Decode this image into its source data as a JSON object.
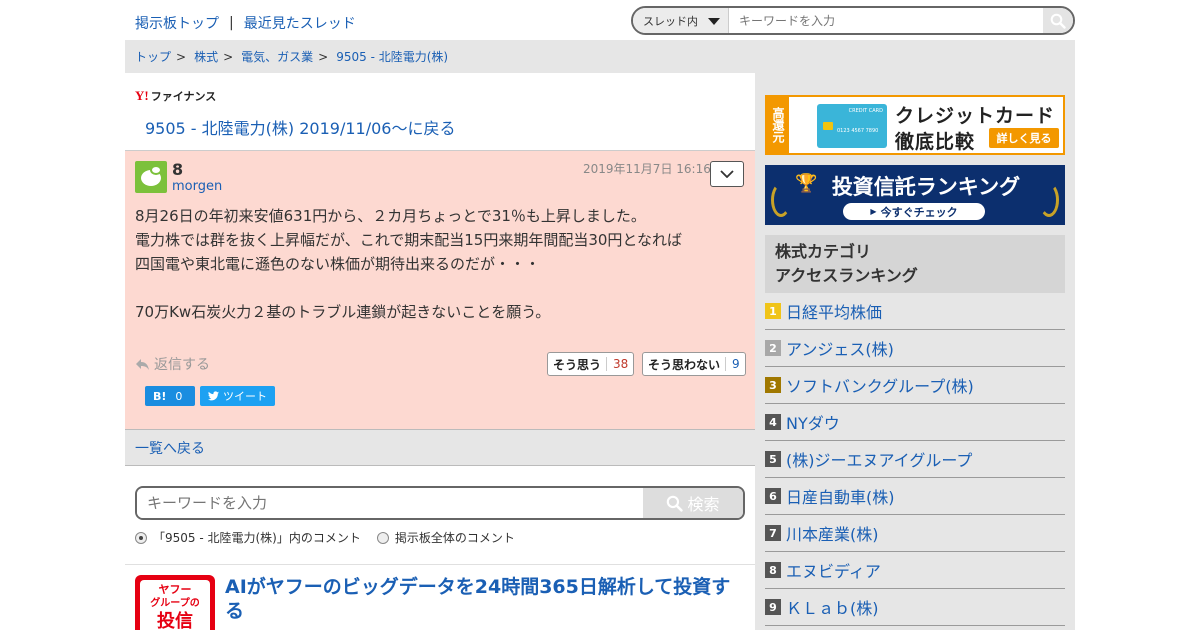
{
  "topnav": {
    "board_top": "掲示板トップ",
    "separator": "|",
    "recent_threads": "最近見たスレッド"
  },
  "top_search": {
    "scope": "スレッド内",
    "placeholder": "キーワードを入力"
  },
  "breadcrumb": [
    {
      "label": "トップ"
    },
    {
      "label": "株式"
    },
    {
      "label": "電気、ガス業"
    },
    {
      "label": "9505 - 北陸電力(株)"
    }
  ],
  "breadcrumb_sep": ">",
  "logo": {
    "mark": "Y!",
    "text": "ファイナンス"
  },
  "back_to_thread": "9505 - 北陸電力(株) 2019/11/06〜に戻る",
  "post": {
    "number": "8",
    "author": "morgen",
    "date": "2019年11月7日 16:16",
    "lines": [
      "8月26日の年初来安値631円から、２カ月ちょっとで31％も上昇しました。",
      "電力株では群を抜く上昇幅だが、これで期末配当15円来期年間配当30円となれば",
      "四国電や東北電に遜色のない株価が期待出来るのだが・・・",
      "",
      "70万Kw石炭火力２基のトラブル連鎖が起きないことを願う。"
    ],
    "reply": "返信する",
    "agree_label": "そう思う",
    "agree_count": "38",
    "disagree_label": "そう思わない",
    "disagree_count": "9",
    "hatena_label": "B!",
    "hatena_count": "0",
    "tweet_label": "ツイート"
  },
  "list_back": "一覧へ戻る",
  "bottom_search": {
    "placeholder": "キーワードを入力",
    "button": "検索",
    "option_thread": "「9505 - 北陸電力(株)」内のコメント",
    "option_all": "掲示板全体のコメント"
  },
  "promo": {
    "image_line1": "ヤフー",
    "image_line2": "グループの",
    "image_line3": "投信",
    "title": "AIがヤフーのビッグデータを24時間365日解析して投資する"
  },
  "ads": {
    "card_tag": "高還元",
    "card_text": "CREDIT CARD",
    "card_numbers": "0123 4567 7890",
    "card_title1": "クレジットカード",
    "card_title2": "徹底比較",
    "card_more": "詳しく見る",
    "fund_title": "投資信託ランキング",
    "fund_button": "今すぐチェック"
  },
  "ranking": {
    "title_line1": "株式カテゴリ",
    "title_line2": "アクセスランキング",
    "items": [
      {
        "rank": "1",
        "name": "日経平均株価"
      },
      {
        "rank": "2",
        "name": "アンジェス(株)"
      },
      {
        "rank": "3",
        "name": "ソフトバンクグループ(株)"
      },
      {
        "rank": "4",
        "name": "NYダウ"
      },
      {
        "rank": "5",
        "name": "(株)ジーエヌアイグループ"
      },
      {
        "rank": "6",
        "name": "日産自動車(株)"
      },
      {
        "rank": "7",
        "name": "川本産業(株)"
      },
      {
        "rank": "8",
        "name": "エヌビディア"
      },
      {
        "rank": "9",
        "name": "ＫＬａｂ(株)"
      }
    ]
  },
  "colors": {
    "link": "#1a5fb4",
    "post_bg": "#fdd9d1",
    "panel_bg": "#e6e6e6",
    "agree": "#c0392b",
    "accent_orange": "#f39800",
    "fund_navy": "#0c2f6e"
  }
}
